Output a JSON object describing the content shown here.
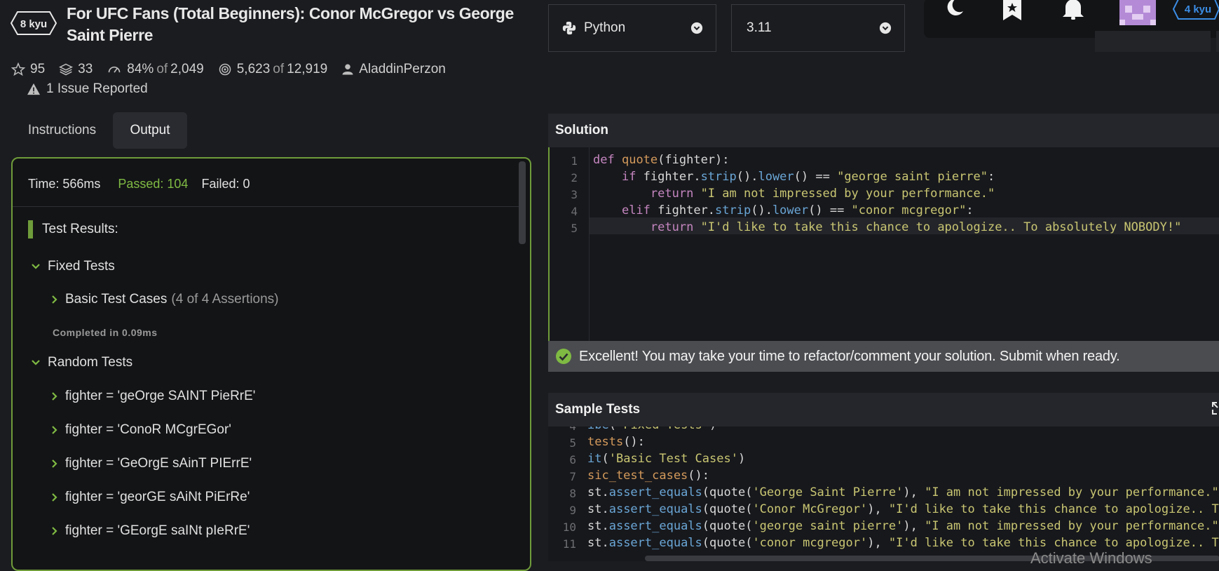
{
  "kata": {
    "rank": "8 kyu",
    "title": "For UFC Fans (Total Beginners): Conor McGregor vs George Saint Pierre",
    "stars": "95",
    "collections": "33",
    "satisfaction_pct": "84%",
    "satisfaction_of": "of",
    "satisfaction_total": "2,049",
    "completions": "5,623",
    "completions_of": "of",
    "completions_total": "12,919",
    "author": "AladdinPerzon",
    "issues": "1 Issue Reported"
  },
  "selects": {
    "language": "Python",
    "version": "3.11"
  },
  "user": {
    "rank": "4 kyu"
  },
  "tabs": {
    "instructions": "Instructions",
    "output": "Output"
  },
  "output": {
    "time": "Time: 566ms",
    "passed": "Passed: 104",
    "failed": "Failed: 0",
    "test_results": "Test Results:",
    "fixed_tests": "Fixed Tests",
    "basic_cases": "Basic Test Cases",
    "basic_assertions": "(4 of 4 Assertions)",
    "completed": "Completed in 0.09ms",
    "random_tests": "Random Tests",
    "random_items": [
      "fighter = 'geOrge SAINT PieRrE'",
      "fighter = 'ConoR MCgrEGor'",
      "fighter = 'GeOrgE sAinT PIErrE'",
      "fighter = 'georGE sAiNt PiErRe'",
      "fighter = 'GEorgE saINt pIeRrE'"
    ]
  },
  "solution": {
    "title": "Solution",
    "success_message": "Excellent! You may take your time to refactor/comment your solution. Submit when ready."
  },
  "sample_tests": {
    "title": "Sample Tests"
  },
  "watermark": "Activate Windows",
  "colors": {
    "background": "#1b1c20",
    "accent_green": "#6f9c3a",
    "passed_green": "#7fba43",
    "link_blue": "#3b8de5"
  },
  "icons": [
    "star-icon",
    "layers-icon",
    "gauge-icon",
    "target-icon",
    "user-icon",
    "warning-icon",
    "python-icon",
    "chevron-down-icon",
    "moon-icon",
    "bookmark-star-icon",
    "bell-icon",
    "check-circle-icon",
    "expand-icon"
  ]
}
